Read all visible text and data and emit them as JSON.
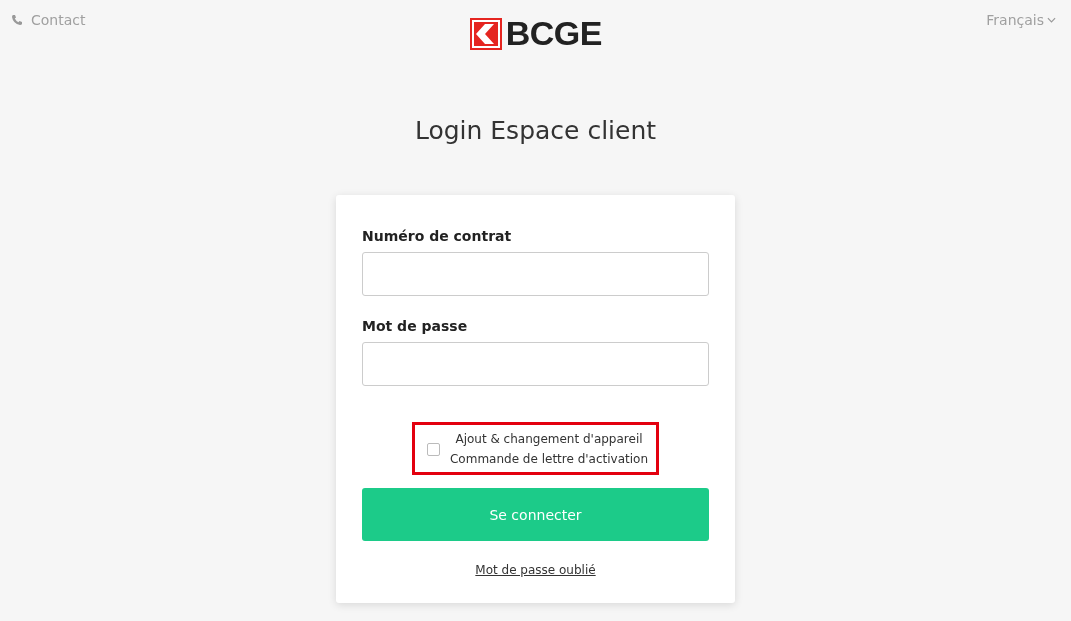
{
  "header": {
    "contact": "Contact",
    "logo": "BCGE",
    "language": "Français"
  },
  "title": "Login Espace client",
  "form": {
    "fields": [
      {
        "label": "Numéro de contrat"
      },
      {
        "label": "Mot de passe"
      }
    ],
    "option": {
      "lines": [
        "Ajout & changement d'appareil",
        "Commande de lettre d'activation"
      ],
      "checked": false,
      "highlighted": true
    },
    "submit": "Se connecter",
    "forgot_link": "Mot de passe oublié"
  }
}
